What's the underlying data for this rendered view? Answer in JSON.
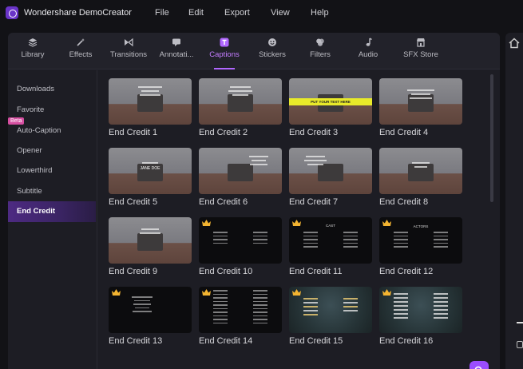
{
  "app": {
    "title": "Wondershare DemoCreator"
  },
  "menu": [
    "File",
    "Edit",
    "Export",
    "View",
    "Help"
  ],
  "tabs": [
    {
      "label": "Library",
      "icon": "library-icon"
    },
    {
      "label": "Effects",
      "icon": "effects-icon"
    },
    {
      "label": "Transitions",
      "icon": "transitions-icon"
    },
    {
      "label": "Annotati...",
      "icon": "annotations-icon"
    },
    {
      "label": "Captions",
      "icon": "captions-icon",
      "active": true
    },
    {
      "label": "Stickers",
      "icon": "stickers-icon"
    },
    {
      "label": "Filters",
      "icon": "filters-icon"
    },
    {
      "label": "Audio",
      "icon": "audio-icon"
    },
    {
      "label": "SFX Store",
      "icon": "sfx-store-icon"
    }
  ],
  "sidebar": {
    "items": [
      "Downloads",
      "Favorite",
      "Auto-Caption",
      "Opener",
      "Lowerthird",
      "Subtitle",
      "End Credit"
    ],
    "active": "End Credit",
    "beta_badge": "Beta"
  },
  "thumb_texts": {
    "yellow_bar": "PUT YOUR TEXT HERE",
    "actors": "ACTORS",
    "cast": "CAST",
    "jane_doe": "JANE DOE"
  },
  "cards": [
    {
      "label": "End Credit 1",
      "style": "photo",
      "premium": false
    },
    {
      "label": "End Credit 2",
      "style": "photo",
      "premium": false
    },
    {
      "label": "End Credit 3",
      "style": "photo",
      "premium": false
    },
    {
      "label": "End Credit 4",
      "style": "photo",
      "premium": false
    },
    {
      "label": "End Credit 5",
      "style": "photo",
      "premium": false
    },
    {
      "label": "End Credit 6",
      "style": "photo",
      "premium": false
    },
    {
      "label": "End Credit 7",
      "style": "photo",
      "premium": false
    },
    {
      "label": "End Credit 8",
      "style": "photo",
      "premium": false
    },
    {
      "label": "End Credit 9",
      "style": "photo",
      "premium": false
    },
    {
      "label": "End Credit 10",
      "style": "dark",
      "premium": true
    },
    {
      "label": "End Credit 11",
      "style": "dark",
      "premium": true
    },
    {
      "label": "End Credit 12",
      "style": "dark",
      "premium": true
    },
    {
      "label": "End Credit 13",
      "style": "dark",
      "premium": true
    },
    {
      "label": "End Credit 14",
      "style": "dark",
      "premium": true
    },
    {
      "label": "End Credit 15",
      "style": "teal",
      "premium": true
    },
    {
      "label": "End Credit 16",
      "style": "teal",
      "premium": true
    }
  ],
  "colors": {
    "accent": "#b067ff",
    "search_button": "#9b4dff",
    "crown": "#f3b431",
    "beta_badge": "#d64fa1"
  }
}
